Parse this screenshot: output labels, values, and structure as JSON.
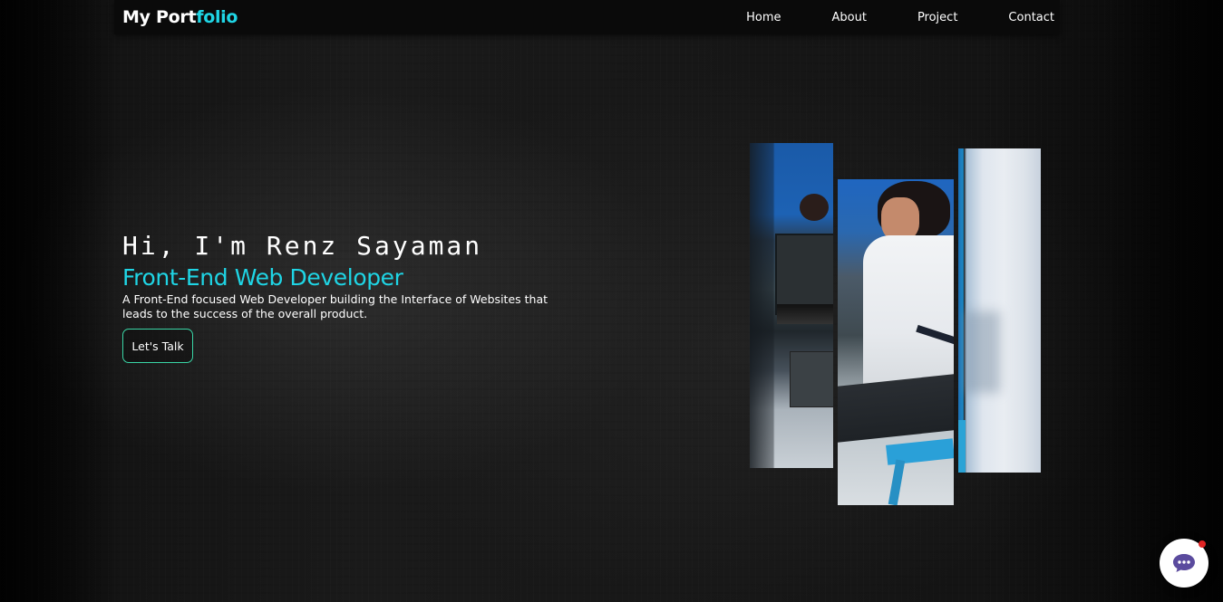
{
  "navbar": {
    "brand_main": "My Port",
    "brand_accent": "folio",
    "links": [
      "Home",
      "About",
      "Project",
      "Contact"
    ]
  },
  "hero": {
    "greeting": "Hi, I'm Renz Sayaman",
    "role": "Front-End Web Developer",
    "description": "A Front-End focused Web Developer building the Interface of Websites that leads to the success of the overall product.",
    "cta_label": "Let's Talk"
  },
  "colors": {
    "accent": "#1fd5e5",
    "button_border": "#3ad6a6",
    "chat_icon": "#5b4b9e",
    "notification": "#e02424"
  },
  "icons": {
    "chat": "chat-bubble-icon"
  }
}
